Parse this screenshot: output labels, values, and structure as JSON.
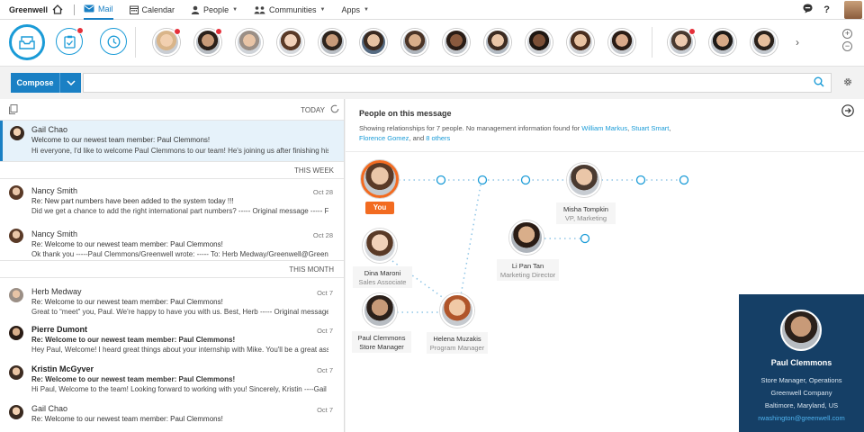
{
  "topnav": {
    "brand": "Greenwell",
    "items": [
      {
        "label": "Mail",
        "icon": "mail-icon"
      },
      {
        "label": "Calendar",
        "icon": "calendar-icon"
      },
      {
        "label": "People",
        "icon": "person-icon"
      },
      {
        "label": "Communities",
        "icon": "communities-icon"
      },
      {
        "label": "Apps",
        "icon": ""
      }
    ],
    "help": "?"
  },
  "strip": {
    "more_arrow": "›",
    "zoom_in": "+",
    "zoom_out": "−"
  },
  "compose": {
    "label": "Compose",
    "search_value": ""
  },
  "mail_list": {
    "sections": {
      "today": "TODAY",
      "this_week": "THIS WEEK",
      "this_month": "THIS MONTH"
    },
    "items": [
      {
        "from": "Gail Chao",
        "date": "",
        "subject": "Welcome to our newest team member: Paul Clemmons!",
        "preview": "Hi everyone, I'd like to welcome Paul Clemmons to our team! He's joining us after finishing his ..."
      },
      {
        "from": "Nancy Smith",
        "date": "Oct 28",
        "subject": "Re: New part numbers have been added to the system today !!!",
        "preview": "Did we get a chance to add the right international part numbers? ----- Original message ----- Fro"
      },
      {
        "from": "Nancy Smith",
        "date": "Oct 28",
        "subject": "Re: Welcome to our newest team member: Paul Clemmons!",
        "preview": "Ok thank you -----Paul Clemmons/Greenwell wrote: ----- To: Herb Medway/Greenwell@Greenwell"
      },
      {
        "from": "Herb Medway",
        "date": "Oct 7",
        "subject": "Re: Welcome to our newest team member: Paul Clemmons!",
        "preview": "Great to “meet” you, Paul. We're happy to have you with us. Best, Herb ----- Original message -"
      },
      {
        "from": "Pierre Dumont",
        "date": "Oct 7",
        "subject": "Re: Welcome to our newest team member: Paul Clemmons!",
        "preview": "Hey Paul, Welcome! I heard great things about your internship with Mike. You'll be a great asset to"
      },
      {
        "from": "Kristin McGyver",
        "date": "Oct 7",
        "subject": "Re: Welcome to our newest team member: Paul Clemmons!",
        "preview": "Hi Paul, Welcome to the team! Looking forward to working with you! Sincerely, Kristin ----Gail ..."
      },
      {
        "from": "Gail Chao",
        "date": "Oct 7",
        "subject": "Re: Welcome to our newest team member: Paul Clemmons!",
        "preview": ""
      }
    ]
  },
  "people": {
    "title": "People on this message",
    "desc_prefix": "Showing relationships for 7 people.  No management information found for ",
    "link1": "William Markus",
    "link2": "Stuart Smart",
    "link3": "Florence Gomez",
    "desc_and": ", and ",
    "link4": "8 others",
    "you_label": "You",
    "nodes": [
      {
        "name": "Misha Tompkin",
        "role": "VP, Marketing"
      },
      {
        "name": "Li Pan Tan",
        "role": "Marketing Director"
      },
      {
        "name": "Dina Maroni",
        "role": "Sales Associate"
      },
      {
        "name": "Paul Clemmons",
        "role": "Store Manager"
      },
      {
        "name": "Helena Muzakis",
        "role": "Program Manager"
      }
    ]
  },
  "profile": {
    "name": "Paul Clemmons",
    "title": "Store Manager, Operations",
    "company": "Greenwell Company",
    "location": "Baltimore, Maryland, US",
    "email": "rwashington@greenwell.com"
  },
  "colors": {
    "accent": "#1a80c4",
    "you": "#f26b21",
    "notify": "#e5303a",
    "profile_bg": "#153f66"
  }
}
